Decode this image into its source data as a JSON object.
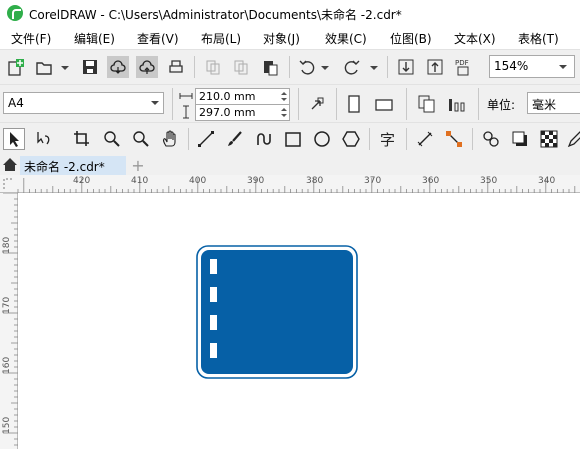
{
  "window": {
    "title": "CorelDRAW - C:\\Users\\Administrator\\Documents\\未命名 -2.cdr*"
  },
  "menu": [
    "文件(F)",
    "编辑(E)",
    "查看(V)",
    "布局(L)",
    "对象(J)",
    "效果(C)",
    "位图(B)",
    "文本(X)",
    "表格(T)"
  ],
  "standard_toolbar": {
    "zoom_value": "154%"
  },
  "property_bar": {
    "page_size": "A4",
    "width": "210.0 mm",
    "height": "297.0 mm",
    "units_label": "单位:",
    "units_value": "毫米"
  },
  "document_tab": {
    "label": "未命名 -2.cdr*"
  },
  "hruler_labels": [
    "420",
    "410",
    "400",
    "390",
    "380",
    "370",
    "360",
    "350",
    "340"
  ],
  "vruler_labels": [
    "180",
    "170",
    "160",
    "150"
  ],
  "colors": {
    "sign_blue": "#0660a6",
    "accent_active": "#c9c9c9",
    "tab_bg": "#d5e5f5"
  }
}
